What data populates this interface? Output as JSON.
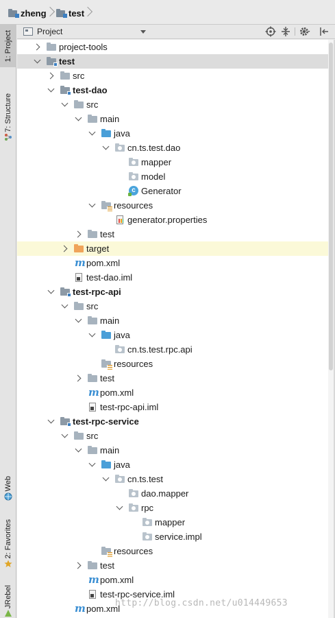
{
  "breadcrumb": [
    {
      "label": "zheng",
      "icon": "module-folder-icon"
    },
    {
      "label": "test",
      "icon": "module-folder-icon"
    }
  ],
  "panel": {
    "title": "Project",
    "buttons": [
      "target-icon",
      "collapse-all-icon",
      "gear-icon",
      "hide-icon"
    ]
  },
  "side_tabs": {
    "project": "1: Project",
    "structure": "7: Structure",
    "web": "Web",
    "favorites": "2: Favorites",
    "jrebel": "JRebel"
  },
  "tree": [
    {
      "label": "project-tools",
      "depth": 0,
      "expand": "collapsed",
      "icon": "folder",
      "bold": false
    },
    {
      "label": "test",
      "depth": 0,
      "expand": "expanded",
      "icon": "module",
      "bold": true,
      "selected": true
    },
    {
      "label": "src",
      "depth": 1,
      "expand": "collapsed",
      "icon": "folder",
      "bold": false
    },
    {
      "label": "test-dao",
      "depth": 1,
      "expand": "expanded",
      "icon": "module",
      "bold": true
    },
    {
      "label": "src",
      "depth": 2,
      "expand": "expanded",
      "icon": "folder",
      "bold": false
    },
    {
      "label": "main",
      "depth": 3,
      "expand": "expanded",
      "icon": "folder",
      "bold": false
    },
    {
      "label": "java",
      "depth": 4,
      "expand": "expanded",
      "icon": "source",
      "bold": false
    },
    {
      "label": "cn.ts.test.dao",
      "depth": 5,
      "expand": "expanded",
      "icon": "package",
      "bold": false
    },
    {
      "label": "mapper",
      "depth": 6,
      "expand": "none",
      "icon": "package",
      "bold": false
    },
    {
      "label": "model",
      "depth": 6,
      "expand": "none",
      "icon": "package",
      "bold": false
    },
    {
      "label": "Generator",
      "depth": 6,
      "expand": "none",
      "icon": "class",
      "bold": false
    },
    {
      "label": "resources",
      "depth": 4,
      "expand": "expanded",
      "icon": "resources",
      "bold": false
    },
    {
      "label": "generator.properties",
      "depth": 5,
      "expand": "none",
      "icon": "properties",
      "bold": false
    },
    {
      "label": "test",
      "depth": 3,
      "expand": "collapsed",
      "icon": "folder",
      "bold": false
    },
    {
      "label": "target",
      "depth": 2,
      "expand": "collapsed",
      "icon": "excluded",
      "bold": false,
      "excluded": true
    },
    {
      "label": "pom.xml",
      "depth": 2,
      "expand": "none",
      "icon": "maven",
      "bold": false
    },
    {
      "label": "test-dao.iml",
      "depth": 2,
      "expand": "none",
      "icon": "iml",
      "bold": false
    },
    {
      "label": "test-rpc-api",
      "depth": 1,
      "expand": "expanded",
      "icon": "module",
      "bold": true
    },
    {
      "label": "src",
      "depth": 2,
      "expand": "expanded",
      "icon": "folder",
      "bold": false
    },
    {
      "label": "main",
      "depth": 3,
      "expand": "expanded",
      "icon": "folder",
      "bold": false
    },
    {
      "label": "java",
      "depth": 4,
      "expand": "expanded",
      "icon": "source",
      "bold": false
    },
    {
      "label": "cn.ts.test.rpc.api",
      "depth": 5,
      "expand": "none",
      "icon": "package",
      "bold": false
    },
    {
      "label": "resources",
      "depth": 4,
      "expand": "none",
      "icon": "resources",
      "bold": false
    },
    {
      "label": "test",
      "depth": 3,
      "expand": "collapsed",
      "icon": "folder",
      "bold": false
    },
    {
      "label": "pom.xml",
      "depth": 3,
      "expand": "none",
      "icon": "maven",
      "bold": false
    },
    {
      "label": "test-rpc-api.iml",
      "depth": 3,
      "expand": "none",
      "icon": "iml",
      "bold": false
    },
    {
      "label": "test-rpc-service",
      "depth": 1,
      "expand": "expanded",
      "icon": "module",
      "bold": true
    },
    {
      "label": "src",
      "depth": 2,
      "expand": "expanded",
      "icon": "folder",
      "bold": false
    },
    {
      "label": "main",
      "depth": 3,
      "expand": "expanded",
      "icon": "folder",
      "bold": false
    },
    {
      "label": "java",
      "depth": 4,
      "expand": "expanded",
      "icon": "source",
      "bold": false
    },
    {
      "label": "cn.ts.test",
      "depth": 5,
      "expand": "expanded",
      "icon": "package",
      "bold": false
    },
    {
      "label": "dao.mapper",
      "depth": 6,
      "expand": "none",
      "icon": "package",
      "bold": false
    },
    {
      "label": "rpc",
      "depth": 6,
      "expand": "expanded",
      "icon": "package",
      "bold": false
    },
    {
      "label": "mapper",
      "depth": 7,
      "expand": "none",
      "icon": "package",
      "bold": false
    },
    {
      "label": "service.impl",
      "depth": 7,
      "expand": "none",
      "icon": "package",
      "bold": false
    },
    {
      "label": "resources",
      "depth": 4,
      "expand": "none",
      "icon": "resources",
      "bold": false
    },
    {
      "label": "test",
      "depth": 3,
      "expand": "collapsed",
      "icon": "folder",
      "bold": false
    },
    {
      "label": "pom.xml",
      "depth": 3,
      "expand": "none",
      "icon": "maven",
      "bold": false
    },
    {
      "label": "test-rpc-service.iml",
      "depth": 3,
      "expand": "none",
      "icon": "iml",
      "bold": false
    },
    {
      "label": "pom.xml",
      "depth": 2,
      "expand": "none",
      "icon": "maven",
      "bold": false
    }
  ],
  "watermark": "http://blog.csdn.net/u014449653",
  "colors": {
    "selected_row": "#dcdcdc",
    "excluded_row": "#fbf9d8",
    "source_folder": "#4a9fd8",
    "excluded_folder": "#f0a45a",
    "maven_icon": "#3b8fd3"
  }
}
